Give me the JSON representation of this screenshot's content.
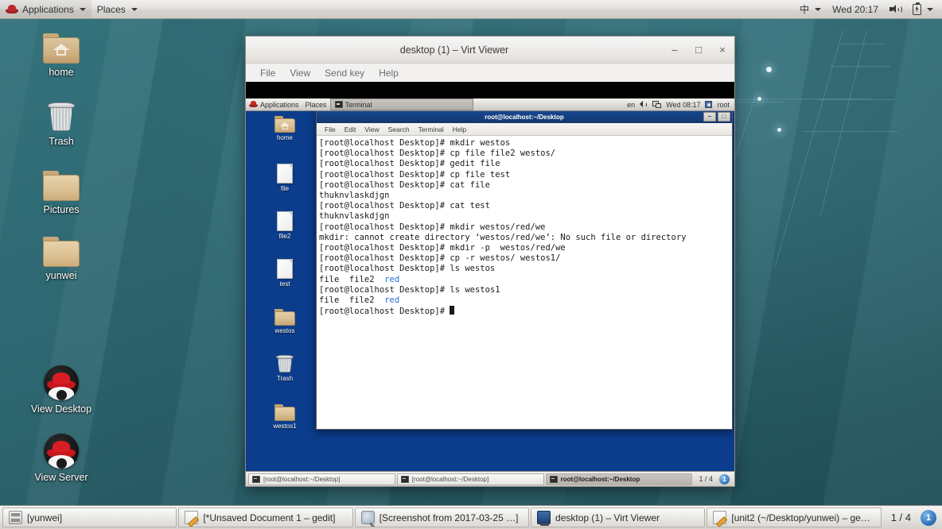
{
  "host": {
    "top_panel": {
      "logo_icon": "redhat-logo-icon",
      "applications_label": "Applications",
      "places_label": "Places",
      "tray": {
        "input_method": "中",
        "volume_icon": "speaker-icon",
        "clock": "Wed 20:17",
        "power_icon": "battery-charging-icon"
      }
    },
    "desktop_icons": [
      {
        "name": "home",
        "label": "home",
        "icon": "folder-home-icon"
      },
      {
        "name": "trash",
        "label": "Trash",
        "icon": "trash-icon"
      },
      {
        "name": "pictures",
        "label": "Pictures",
        "icon": "folder-icon"
      },
      {
        "name": "yunwei",
        "label": "yunwei",
        "icon": "folder-icon"
      },
      {
        "name": "view-desktop",
        "label": "View Desktop",
        "icon": "redhat-badge-icon"
      },
      {
        "name": "view-server",
        "label": "View Server",
        "icon": "redhat-badge-icon"
      }
    ],
    "taskbar": {
      "buttons": [
        {
          "name": "yunwei",
          "label": "[yunwei]",
          "icon": "files-icon",
          "active": false
        },
        {
          "name": "gedit-1",
          "label": "[*Unsaved Document 1 – gedit]",
          "icon": "gedit-icon",
          "active": false
        },
        {
          "name": "screenshot",
          "label": "[Screenshot from 2017-03-25 …]",
          "icon": "screenshot-icon",
          "active": false
        },
        {
          "name": "virt-viewer",
          "label": "desktop (1) – Virt Viewer",
          "icon": "virt-viewer-icon",
          "active": true
        },
        {
          "name": "gedit-2",
          "label": "[unit2 (~/Desktop/yunwei) – ged…]",
          "icon": "gedit-icon",
          "active": false
        }
      ],
      "workspace_count": "1 / 4",
      "workspace_badge": "1"
    }
  },
  "virt_viewer": {
    "title": "desktop (1) – Virt Viewer",
    "window_buttons": {
      "minimize": "–",
      "maximize": "□",
      "close": "×"
    },
    "menu": [
      "File",
      "View",
      "Send key",
      "Help"
    ]
  },
  "guest": {
    "top_panel": {
      "logo_icon": "redhat-logo-icon",
      "applications_label": "Applications",
      "places_label": "Places",
      "window_entry": "Terminal",
      "tray": {
        "input_method": "en",
        "volume_icon": "speaker-icon",
        "network_icon": "network-icon",
        "clock": "Wed 08:17",
        "user_icon": "user-icon",
        "user": "root"
      }
    },
    "desktop_icons": [
      {
        "name": "home",
        "label": "home",
        "icon": "folder-home-icon"
      },
      {
        "name": "file",
        "label": "file",
        "icon": "file-icon"
      },
      {
        "name": "file2",
        "label": "file2",
        "icon": "file-icon"
      },
      {
        "name": "test",
        "label": "test",
        "icon": "file-icon"
      },
      {
        "name": "westos",
        "label": "westos",
        "icon": "folder-icon"
      },
      {
        "name": "trash",
        "label": "Trash",
        "icon": "trash-icon"
      },
      {
        "name": "westos1",
        "label": "westos1",
        "icon": "folder-icon"
      }
    ],
    "terminal": {
      "title": "root@localhost:~/Desktop",
      "menu": [
        "File",
        "Edit",
        "View",
        "Search",
        "Terminal",
        "Help"
      ],
      "window_buttons": {
        "minimize": "–",
        "maximize": "□"
      },
      "prompt": "[root@localhost Desktop]# ",
      "dir_color": "#2b6fd6",
      "lines": [
        {
          "type": "cmd",
          "text": "mkdir westos"
        },
        {
          "type": "cmd",
          "text": "cp file file2 westos/"
        },
        {
          "type": "cmd",
          "text": "gedit file"
        },
        {
          "type": "cmd",
          "text": "cp file test"
        },
        {
          "type": "cmd",
          "text": "cat file"
        },
        {
          "type": "out",
          "text": "thuknvlaskdjgn"
        },
        {
          "type": "cmd",
          "text": "cat test"
        },
        {
          "type": "out",
          "text": "thuknvlaskdjgn"
        },
        {
          "type": "cmd",
          "text": "mkdir westos/red/we"
        },
        {
          "type": "out",
          "text": "mkdir: cannot create directory ‘westos/red/we’: No such file or directory"
        },
        {
          "type": "cmd",
          "text": "mkdir -p  westos/red/we"
        },
        {
          "type": "cmd",
          "text": "cp -r westos/ westos1/"
        },
        {
          "type": "cmd",
          "text": "ls westos"
        },
        {
          "type": "ls",
          "text": "file  file2  ",
          "dir": "red"
        },
        {
          "type": "cmd",
          "text": "ls westos1"
        },
        {
          "type": "ls",
          "text": "file  file2  ",
          "dir": "red"
        },
        {
          "type": "cursor",
          "text": ""
        }
      ]
    },
    "taskbar": {
      "buttons": [
        {
          "name": "term-1",
          "label": "[root@localhost:~/Desktop]",
          "icon": "terminal-icon",
          "active": false
        },
        {
          "name": "term-2",
          "label": "[root@localhost:~/Desktop]",
          "icon": "terminal-icon",
          "active": false
        },
        {
          "name": "term-3",
          "label": "root@localhost:~/Desktop",
          "icon": "terminal-icon",
          "active": true
        }
      ],
      "workspace_count": "1 / 4",
      "workspace_badge": "1"
    }
  },
  "colors": {
    "host_desktop": "#2d6670",
    "guest_desktop": "#0b3d8c",
    "terminal_bg": "#ffffff",
    "terminal_fg": "#1a1a1a",
    "terminal_dir": "#2b6fd6",
    "title_blue": "#18478f"
  }
}
